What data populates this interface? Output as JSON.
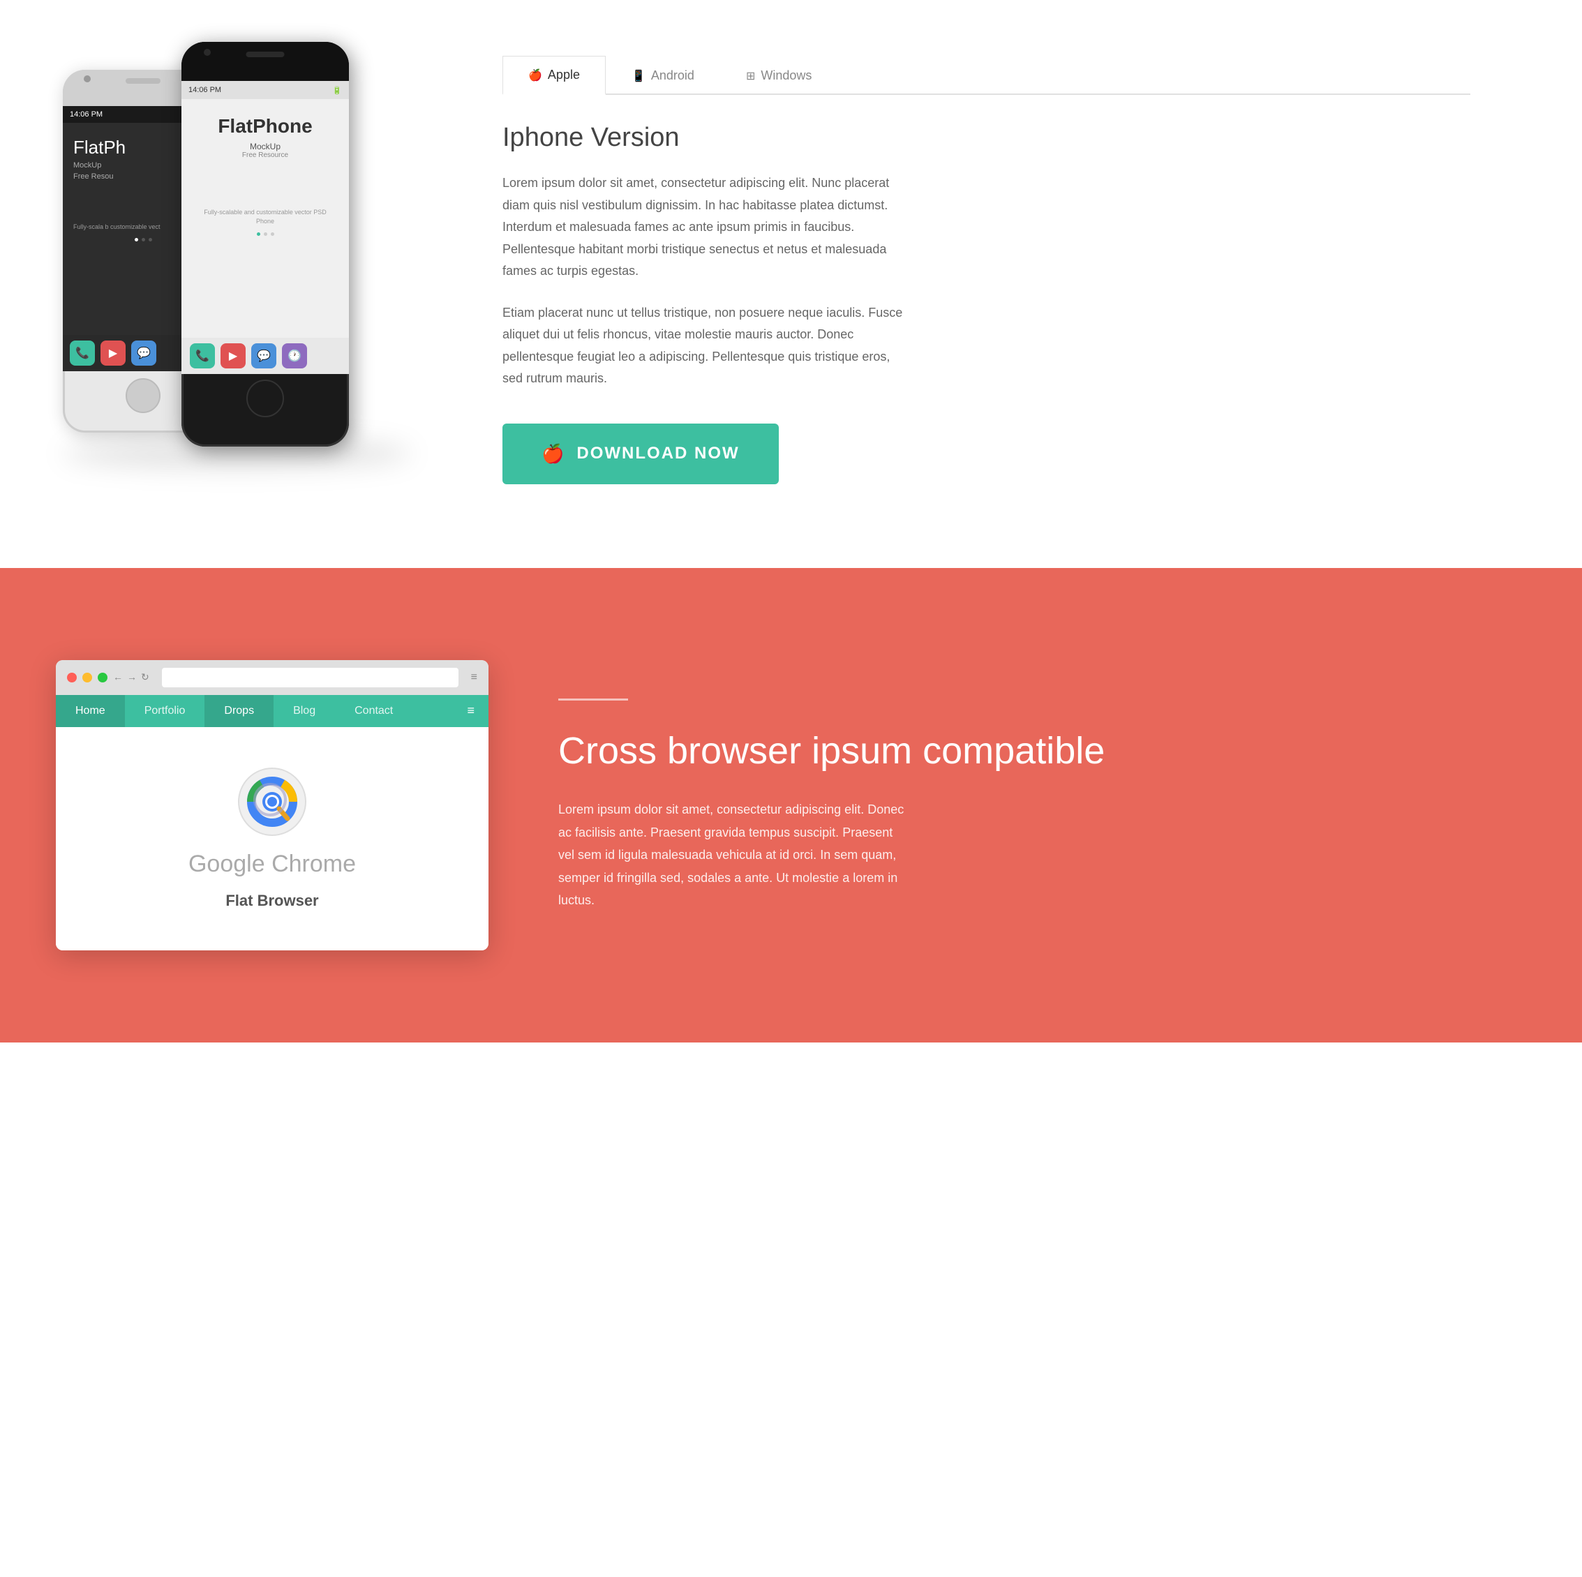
{
  "section_top": {
    "phone_white": {
      "time": "14:06 PM",
      "app_title_part1": "FlatPh",
      "app_title_full": "FlatPhone",
      "mock_label": "MockUp",
      "free_label": "Free Resou",
      "desc_text": "Fully-scala b customizable vect"
    },
    "phone_black": {
      "time": "14:06 PM",
      "app_title_plain": "Flat",
      "app_title_bold": "Phone",
      "mock_label": "MockUp",
      "free_label": "Free Resource",
      "desc_text": "Fully-scalable and customizable vector PSD Phone"
    },
    "tabs": [
      {
        "id": "apple",
        "label": "Apple",
        "icon": "🍎",
        "active": true
      },
      {
        "id": "android",
        "label": "Android",
        "icon": "📱",
        "active": false
      },
      {
        "id": "windows",
        "label": "Windows",
        "icon": "⊞",
        "active": false
      }
    ],
    "title": "Iphone Version",
    "paragraph1": "Lorem ipsum dolor sit amet, consectetur adipiscing elit. Nunc placerat diam quis nisl vestibulum dignissim. In hac habitasse platea dictumst. Interdum et malesuada fames ac ante ipsum primis in faucibus. Pellentesque habitant morbi tristique senectus et netus et malesuada fames ac turpis egestas.",
    "paragraph2": "Etiam placerat nunc ut tellus tristique, non posuere neque iaculis. Fusce aliquet dui ut felis rhoncus, vitae molestie mauris auctor. Donec pellentesque feugiat leo a adipiscing. Pellentesque quis tristique eros, sed rutrum mauris.",
    "download_btn_label": "DOWNLOAD NOW"
  },
  "section_bottom": {
    "browser_nav": [
      {
        "label": "Home",
        "active": true
      },
      {
        "label": "Portfolio",
        "active": false
      },
      {
        "label": "Drops",
        "active": true
      },
      {
        "label": "Blog",
        "active": false
      },
      {
        "label": "Contact",
        "active": false
      }
    ],
    "app_name": "Google Chrome",
    "app_type": "Flat Browser",
    "heading": "Cross browser ipsum compatible",
    "body_text": "Lorem ipsum dolor sit amet, consectetur adipiscing elit. Donec ac facilisis ante. Praesent gravida tempus suscipit. Praesent vel sem id ligula malesuada vehicula at id orci. In sem quam, semper id fringilla sed, sodales a ante. Ut molestie a lorem in luctus.",
    "bg_color": "#e8675a",
    "accent_color": "#3dbfa0"
  }
}
